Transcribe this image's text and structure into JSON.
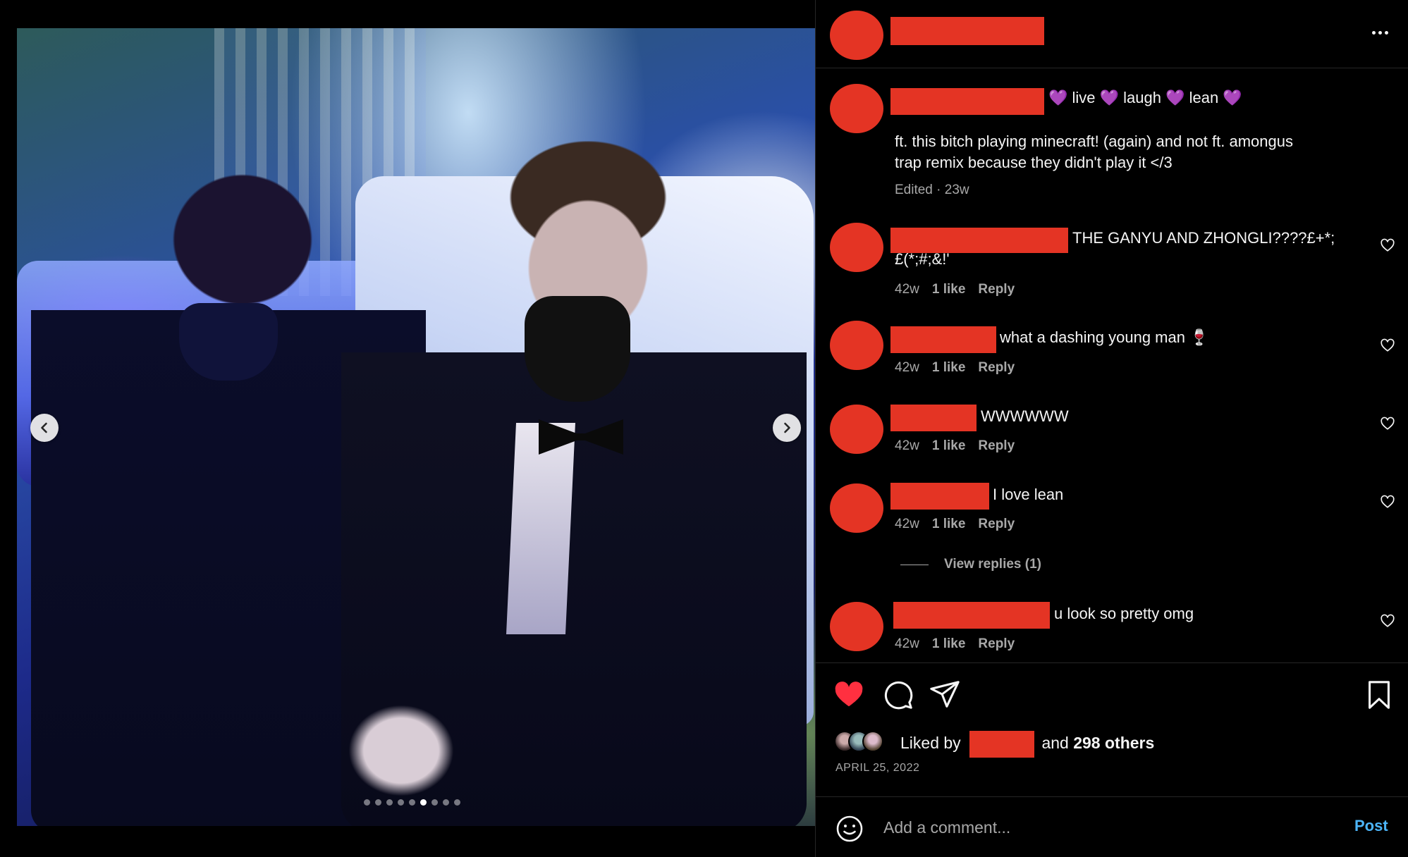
{
  "photo": {
    "carousel": {
      "total_slides": 9,
      "active_index": 5
    },
    "prev_icon": "chevron-left-icon",
    "next_icon": "chevron-right-icon"
  },
  "header": {
    "more_icon": "more-horizontal-icon"
  },
  "caption": {
    "headline": "💜 live 💜 laugh 💜 lean 💜",
    "body_line1": "ft. this bitch playing minecraft! (again) and not ft. amongus",
    "body_line2": "trap remix because they didn't play it </3",
    "edited": "Edited",
    "separator": " · ",
    "time": "23w"
  },
  "comments": [
    {
      "text_line1": "THE GANYU AND ZHONGLI????£+*;",
      "text_line2": "£(*;#;&!'",
      "time": "42w",
      "likes": "1 like",
      "reply": "Reply"
    },
    {
      "text_line1": "what a dashing young man 🍷",
      "time": "42w",
      "likes": "1 like",
      "reply": "Reply"
    },
    {
      "text_line1": "WWWWWW",
      "time": "42w",
      "likes": "1 like",
      "reply": "Reply"
    },
    {
      "text_line1": "I love lean",
      "time": "42w",
      "likes": "1 like",
      "reply": "Reply"
    },
    {
      "text_line1": "u look so pretty omg",
      "time": "42w",
      "likes": "1 like",
      "reply": "Reply"
    }
  ],
  "view_replies": "View replies (1)",
  "actions": {
    "like_icon": "heart-filled-icon",
    "comment_icon": "comment-icon",
    "share_icon": "send-icon",
    "save_icon": "bookmark-icon",
    "like_color": "#ff3040"
  },
  "likes": {
    "prefix": "Liked by",
    "and": "and",
    "count": "298 others"
  },
  "date": "APRIL 25, 2022",
  "add_comment": {
    "placeholder": "Add a comment...",
    "post_label": "Post",
    "emoji_icon": "smiley-icon"
  },
  "colors": {
    "redaction": "#e43424",
    "post_blue": "#4cb5f9",
    "muted": "#a8a8a8"
  }
}
